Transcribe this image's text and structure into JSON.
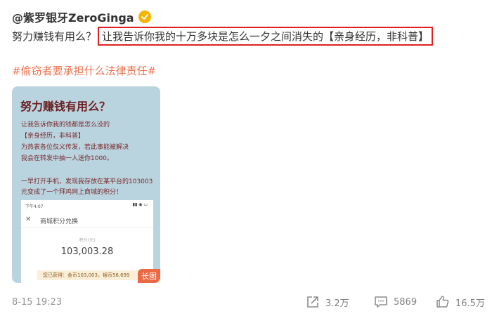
{
  "post": {
    "author": "@紫罗银牙ZeroGinga",
    "verified_icon": "verified-gold-badge",
    "text_prefix": "努力赚钱有用么？",
    "text_highlight": "让我告诉你我的十万多块是怎么一夕之间消失的【亲身经历，非科普】",
    "topic": "#偷窃者要承担什么法律责任#",
    "date": "8-15 19:23"
  },
  "image_card": {
    "title": "努力赚钱有用么？",
    "lines": [
      "让我告诉你我的钱都是怎么没的",
      "【亲身经历，非科普】",
      "为热衷各位仅义传发，若此事能被解决",
      "我会在转发中抽一人送你1000。",
      "一早打开手机，发现我存放在某平台的103003",
      "元变成了一个拜鸡网上商城的积分！"
    ],
    "phone": {
      "status_time": "下午4:07",
      "status_icons": "▮▮ ◉ ▭",
      "close_icon": "close-icon",
      "screen_title": "商城积分兑换",
      "balance_label": "积分(元)",
      "balance": "103,003.28",
      "gained": "您已获得：金币103,003，银币56,699"
    },
    "badge": "长图"
  },
  "actions": {
    "share_count": "3.2万",
    "comment_count": "5869",
    "like_count": "16.5万"
  },
  "colors": {
    "highlight_border": "#e02020",
    "topic": "#eb7350",
    "card_bg": "#b9d3df",
    "badge_bg": "#ec6a43"
  }
}
